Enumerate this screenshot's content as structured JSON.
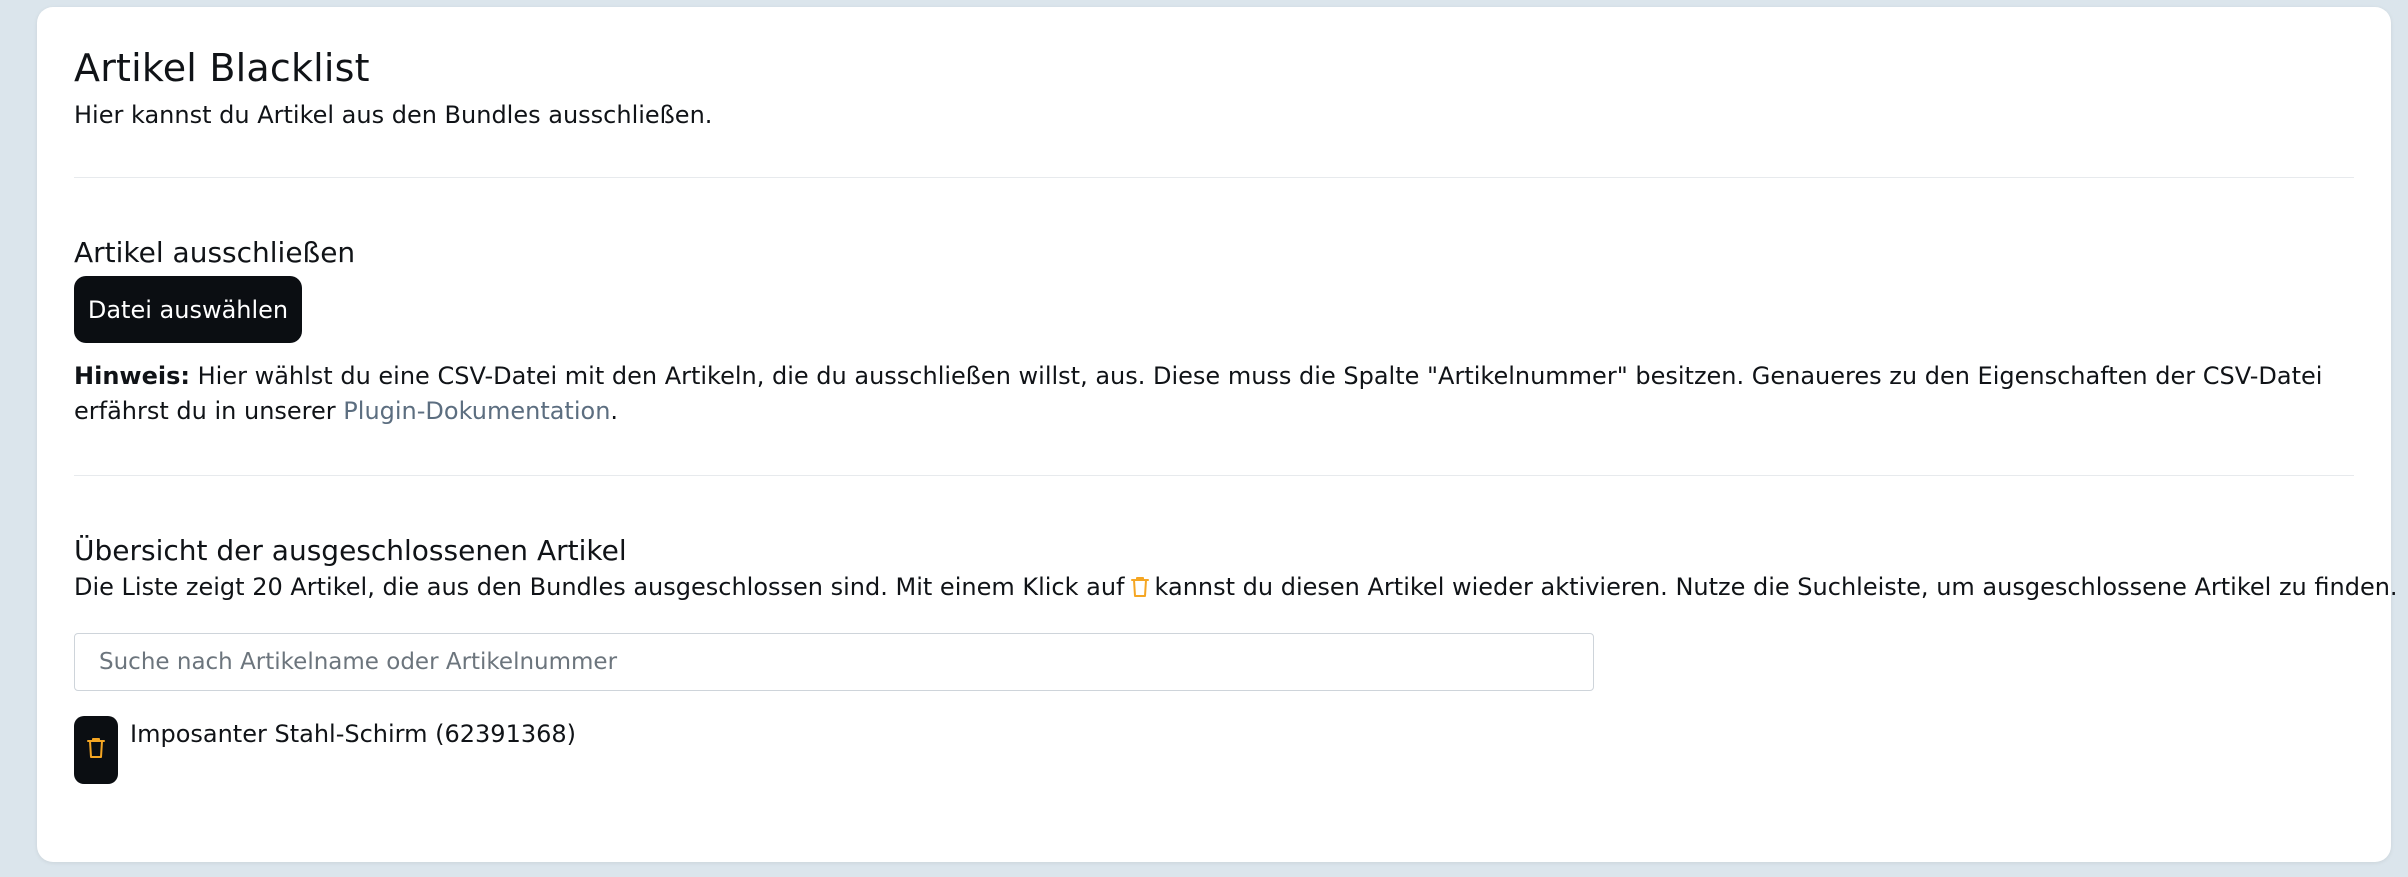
{
  "header": {
    "title": "Artikel Blacklist",
    "subtitle": "Hier kannst du Artikel aus den Bundles ausschließen."
  },
  "exclude_section": {
    "title": "Artikel ausschließen",
    "file_button_label": "Datei auswählen",
    "hint_label": "Hinweis:",
    "hint_text": " Hier wählst du eine CSV-Datei mit den Artikeln, die du ausschließen willst, aus. Diese muss die Spalte \"Artikelnummer\" besitzen. Genaueres zu den Eigenschaften der CSV-Datei erfährst du in unserer ",
    "hint_link": "Plugin-Dokumentation",
    "hint_end": "."
  },
  "overview_section": {
    "title": "Übersicht der ausgeschlossenen Artikel",
    "desc_before": "Die Liste zeigt 20 Artikel, die aus den Bundles ausgeschlossen sind. Mit einem Klick auf",
    "desc_after": "kannst du diesen Artikel wieder aktivieren. Nutze die Suchleiste, um ausgeschlossene Artikel zu finden.",
    "search_placeholder": "Suche nach Artikelname oder Artikelnummer",
    "search_value": "",
    "items": [
      {
        "label": "Imposanter Stahl-Schirm (62391368)",
        "icon": "trash-icon"
      }
    ]
  },
  "colors": {
    "primary_dark": "#0b0e12",
    "accent_orange": "#f5a623",
    "link": "#5c6e80",
    "background": "#dbe5ec"
  }
}
